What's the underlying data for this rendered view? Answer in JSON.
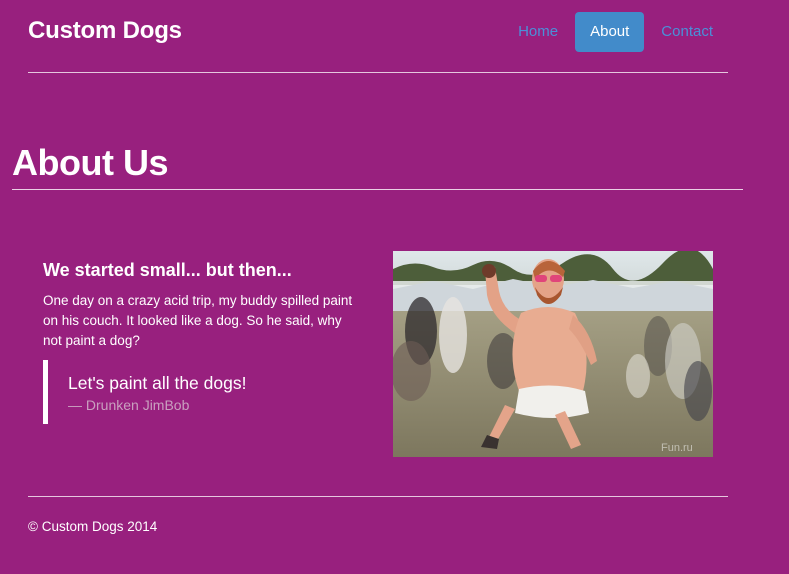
{
  "header": {
    "brand": "Custom Dogs",
    "nav": [
      {
        "label": "Home",
        "active": false
      },
      {
        "label": "About",
        "active": true
      },
      {
        "label": "Contact",
        "active": false
      }
    ]
  },
  "main": {
    "title": "About Us",
    "story": {
      "heading": "We started small... but then...",
      "body": "One day on a crazy acid trip, my buddy spilled paint on his couch. It looked like a dog. So he said, why not paint a dog?"
    },
    "quote": {
      "text": "Let's paint all the dogs!",
      "cite": "— Drunken JimBob"
    },
    "photo_watermark": "Fun.ru"
  },
  "footer": {
    "copyright": "© Custom Dogs 2014"
  },
  "colors": {
    "background": "#98207e",
    "nav_link": "#4a90d9",
    "nav_active_bg": "#428bca",
    "quote_cite": "#c9a0bf"
  }
}
